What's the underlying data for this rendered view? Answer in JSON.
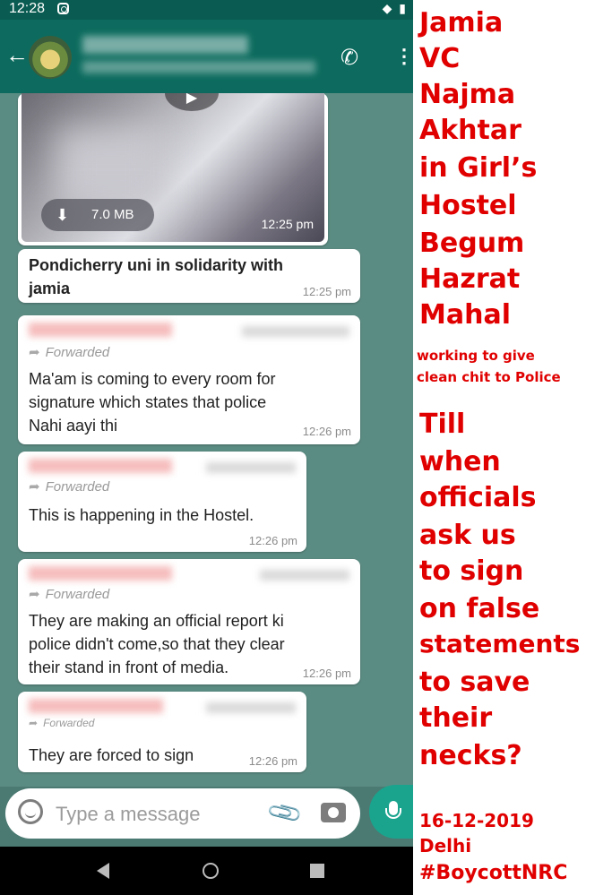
{
  "status_bar": {
    "time": "12:28",
    "icons": "◆ ▮"
  },
  "app_bar": {
    "back": "←",
    "add_call": "✆",
    "more": "⋮"
  },
  "video_message": {
    "size": "7.0 MB",
    "time": "12:25 pm",
    "play": "▶"
  },
  "messages": [
    {
      "text_lines": [
        "Pondicherry uni in solidarity with",
        "jamia"
      ],
      "time": "12:25 pm"
    },
    {
      "forwarded": "Forwarded",
      "text_lines": [
        "Ma'am is coming to every room for",
        "signature which states that police",
        "Nahi aayi thi"
      ],
      "time": "12:26 pm"
    },
    {
      "forwarded": "Forwarded",
      "text_lines": [
        "This is happening in the Hostel."
      ],
      "time": "12:26 pm"
    },
    {
      "forwarded": "Forwarded",
      "text_lines": [
        "They are making an official report ki",
        "police didn't come,so that they clear",
        "their stand in front of media."
      ],
      "time": "12:26 pm"
    },
    {
      "forwarded": "Forwarded",
      "text_lines": [
        "They are forced to sign"
      ],
      "time": "12:26 pm"
    }
  ],
  "composer": {
    "placeholder": "Type a message"
  },
  "caption": {
    "headline": [
      "Jamia",
      "VC",
      "Najma",
      "Akhtar",
      "in Girl’s",
      "Hostel",
      "Begum",
      "Hazrat",
      "Mahal"
    ],
    "subline": [
      "working to give",
      "clean chit to Police"
    ],
    "question": [
      "Till",
      "when",
      "officials",
      "ask us",
      "to sign",
      "on false",
      "statements",
      "to save",
      "their",
      "necks?"
    ],
    "date": "16-12-2019",
    "place": "Delhi",
    "hashtag": "#BoycottNRC"
  },
  "colors": {
    "accent_red": "#e00000",
    "app_bar": "#0c6b5e",
    "chat_bg": "#5b8c83",
    "mic": "#1aa48e"
  }
}
